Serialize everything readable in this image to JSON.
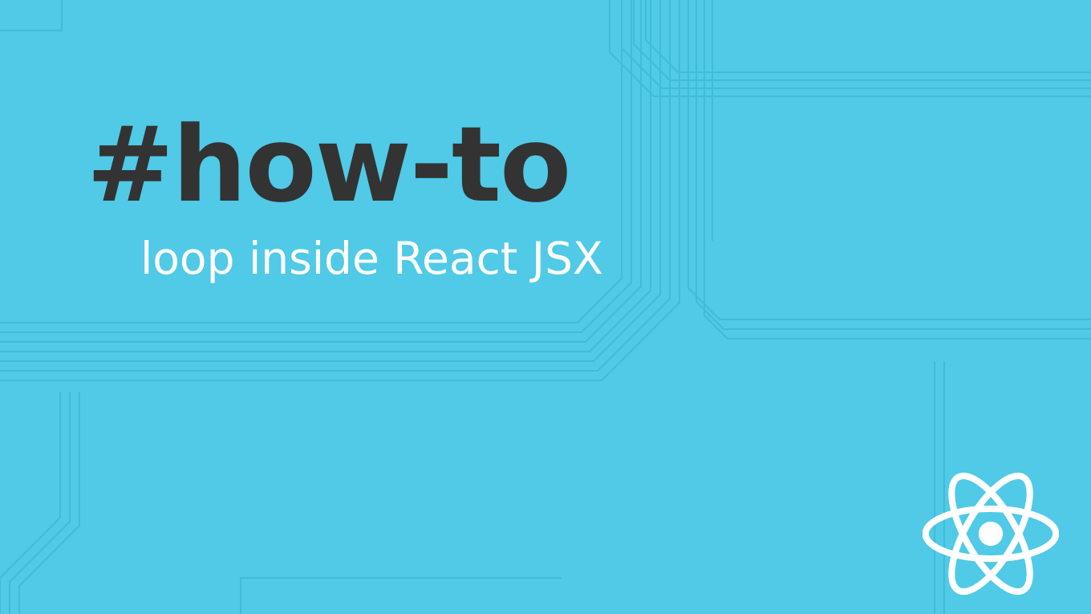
{
  "heading": "#how-to",
  "subheading": "loop inside React JSX",
  "colors": {
    "background": "#50cae6",
    "heading": "#333333",
    "subheading": "#ffffff",
    "logo": "#ffffff",
    "circuit": "#40bcd8"
  },
  "icon": "react-logo"
}
